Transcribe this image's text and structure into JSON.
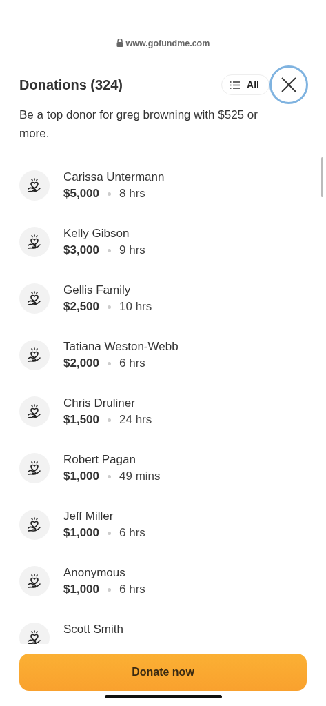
{
  "browser": {
    "url": "www.gofundme.com"
  },
  "header": {
    "title": "Donations (324)",
    "filter": "All"
  },
  "subtitle": "Be a top donor for greg browning with $525 or more.",
  "donations": [
    {
      "name": "Carissa Untermann",
      "amount": "$5,000",
      "time": "8 hrs"
    },
    {
      "name": "Kelly Gibson",
      "amount": "$3,000",
      "time": "9 hrs"
    },
    {
      "name": "Gellis Family",
      "amount": "$2,500",
      "time": "10 hrs"
    },
    {
      "name": "Tatiana Weston-Webb",
      "amount": "$2,000",
      "time": "6 hrs"
    },
    {
      "name": "Chris Druliner",
      "amount": "$1,500",
      "time": "24 hrs"
    },
    {
      "name": "Robert Pagan",
      "amount": "$1,000",
      "time": "49 mins"
    },
    {
      "name": "Jeff Miller",
      "amount": "$1,000",
      "time": "6 hrs"
    },
    {
      "name": "Anonymous",
      "amount": "$1,000",
      "time": "6 hrs"
    },
    {
      "name": "Scott Smith"
    }
  ],
  "donate_button": "Donate now"
}
